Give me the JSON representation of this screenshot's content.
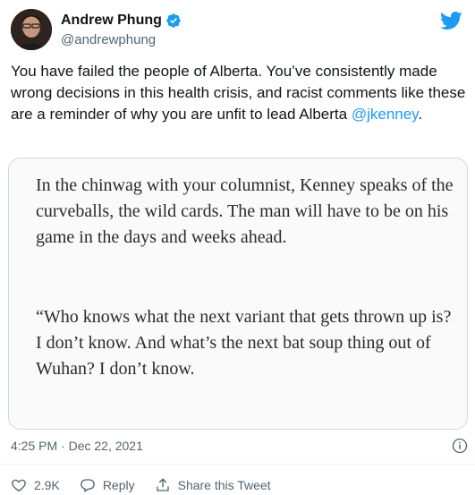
{
  "author": {
    "name": "Andrew Phung",
    "handle": "@andrewphung"
  },
  "tweet": {
    "text_main": "You have failed the people of Alberta. You’ve consistently made wrong decisions in this health crisis, and racist comments like these are a reminder of why you are unfit to lead Alberta ",
    "mention": "@jkenney",
    "text_end": "."
  },
  "media": {
    "paragraph1": "In the chinwag with your columnist, Kenney speaks of the curveballs, the wild cards. The man will have to be on his game in the days and weeks ahead.",
    "paragraph2": "“Who knows what the next variant that gets thrown up is? I don’t know. And what’s the next bat soup thing out of Wuhan? I don’t know."
  },
  "meta": {
    "timestamp": "4:25 PM · Dec 22, 2021"
  },
  "actions": {
    "likes": "2.9K",
    "reply": "Reply",
    "share": "Share this Tweet"
  },
  "colors": {
    "accent": "#1d9bf0",
    "text": "#0f1419",
    "secondary": "#536471"
  }
}
